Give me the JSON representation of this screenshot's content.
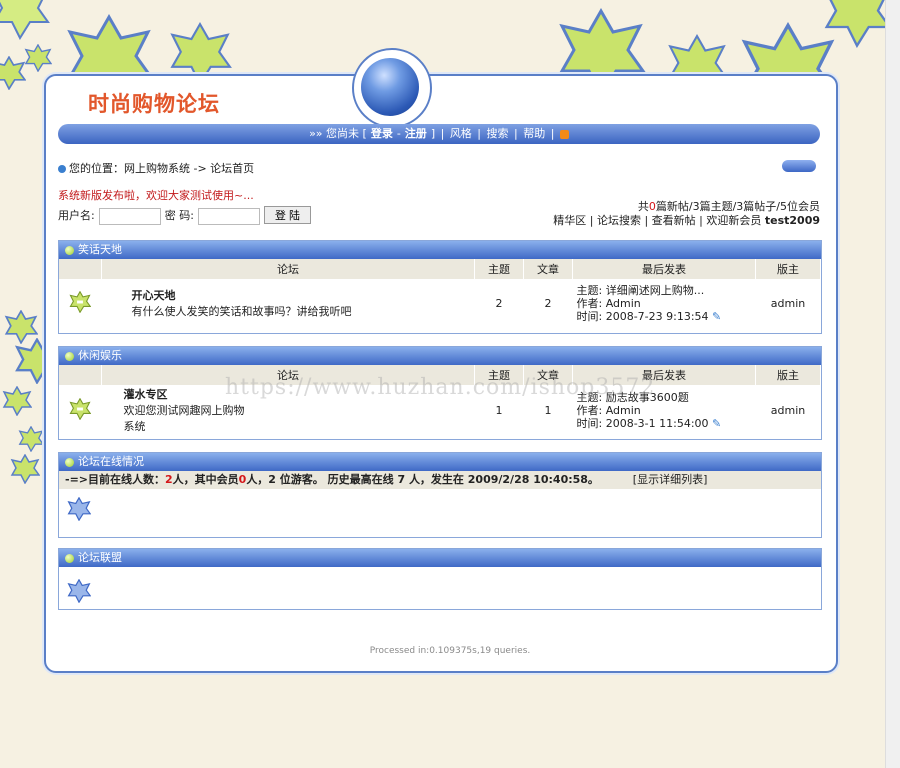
{
  "site_title": "时尚购物论坛",
  "nav": {
    "prefix": "»» 您尚未 [",
    "login": "登录",
    "sep1": "-",
    "register": "注册",
    "suffix": "]",
    "style": "风格",
    "search": "搜索",
    "help": "帮助"
  },
  "breadcrumb": "您的位置：网上购物系统 -> 论坛首页",
  "notice": "系统新版发布啦，欢迎大家测试使用~...",
  "login_form": {
    "user_label": "用户名:",
    "pass_label": "密 码:",
    "submit": "登 陆"
  },
  "stats": {
    "line1_pre": "共",
    "new_posts": "0",
    "line1_post": "篇新帖/3篇主题/3篇帖子/5位会员",
    "links": [
      "精华区",
      "论坛搜索",
      "查看新帖"
    ],
    "welcome": "欢迎新会员",
    "new_member": "test2009"
  },
  "sections": [
    {
      "title": "笑话天地",
      "headers": [
        "论坛",
        "主题",
        "文章",
        "最后发表",
        "版主"
      ],
      "forum_name": "开心天地",
      "forum_desc": "有什么使人发笑的笑话和故事吗？讲给我听吧",
      "topics": "2",
      "posts": "2",
      "last_subject": "主题: 详细阐述网上购物...",
      "last_author": "作者: Admin",
      "last_time": "时间: 2008-7-23 9:13:54",
      "moderator": "admin"
    },
    {
      "title": "休闲娱乐",
      "headers": [
        "论坛",
        "主题",
        "文章",
        "最后发表",
        "版主"
      ],
      "forum_name": "灌水专区",
      "forum_desc": "欢迎您测试网趣网上购物系统",
      "topics": "1",
      "posts": "1",
      "last_subject": "主题: 励志故事3600题",
      "last_author": "作者: Admin",
      "last_time": "时间: 2008-3-1 11:54:00",
      "moderator": "admin"
    }
  ],
  "online": {
    "title": "论坛在线情况",
    "text_a": "-=>目前在线人数：",
    "total": "2",
    "text_b": "人，其中会员",
    "members": "0",
    "text_c": "人，2 位游客。 历史最高在线 7 人，发生在 2009/2/28 10:40:58。",
    "detail_link": "[显示详细列表]"
  },
  "alliance": {
    "title": "论坛联盟"
  },
  "footer": "Processed in:0.109375s,19 queries.",
  "watermark": "https://www.huzhan.com/ishop3572",
  "colors": {
    "accent": "#3f69c6",
    "star": "#c9e36b",
    "title": "#e2572b"
  }
}
